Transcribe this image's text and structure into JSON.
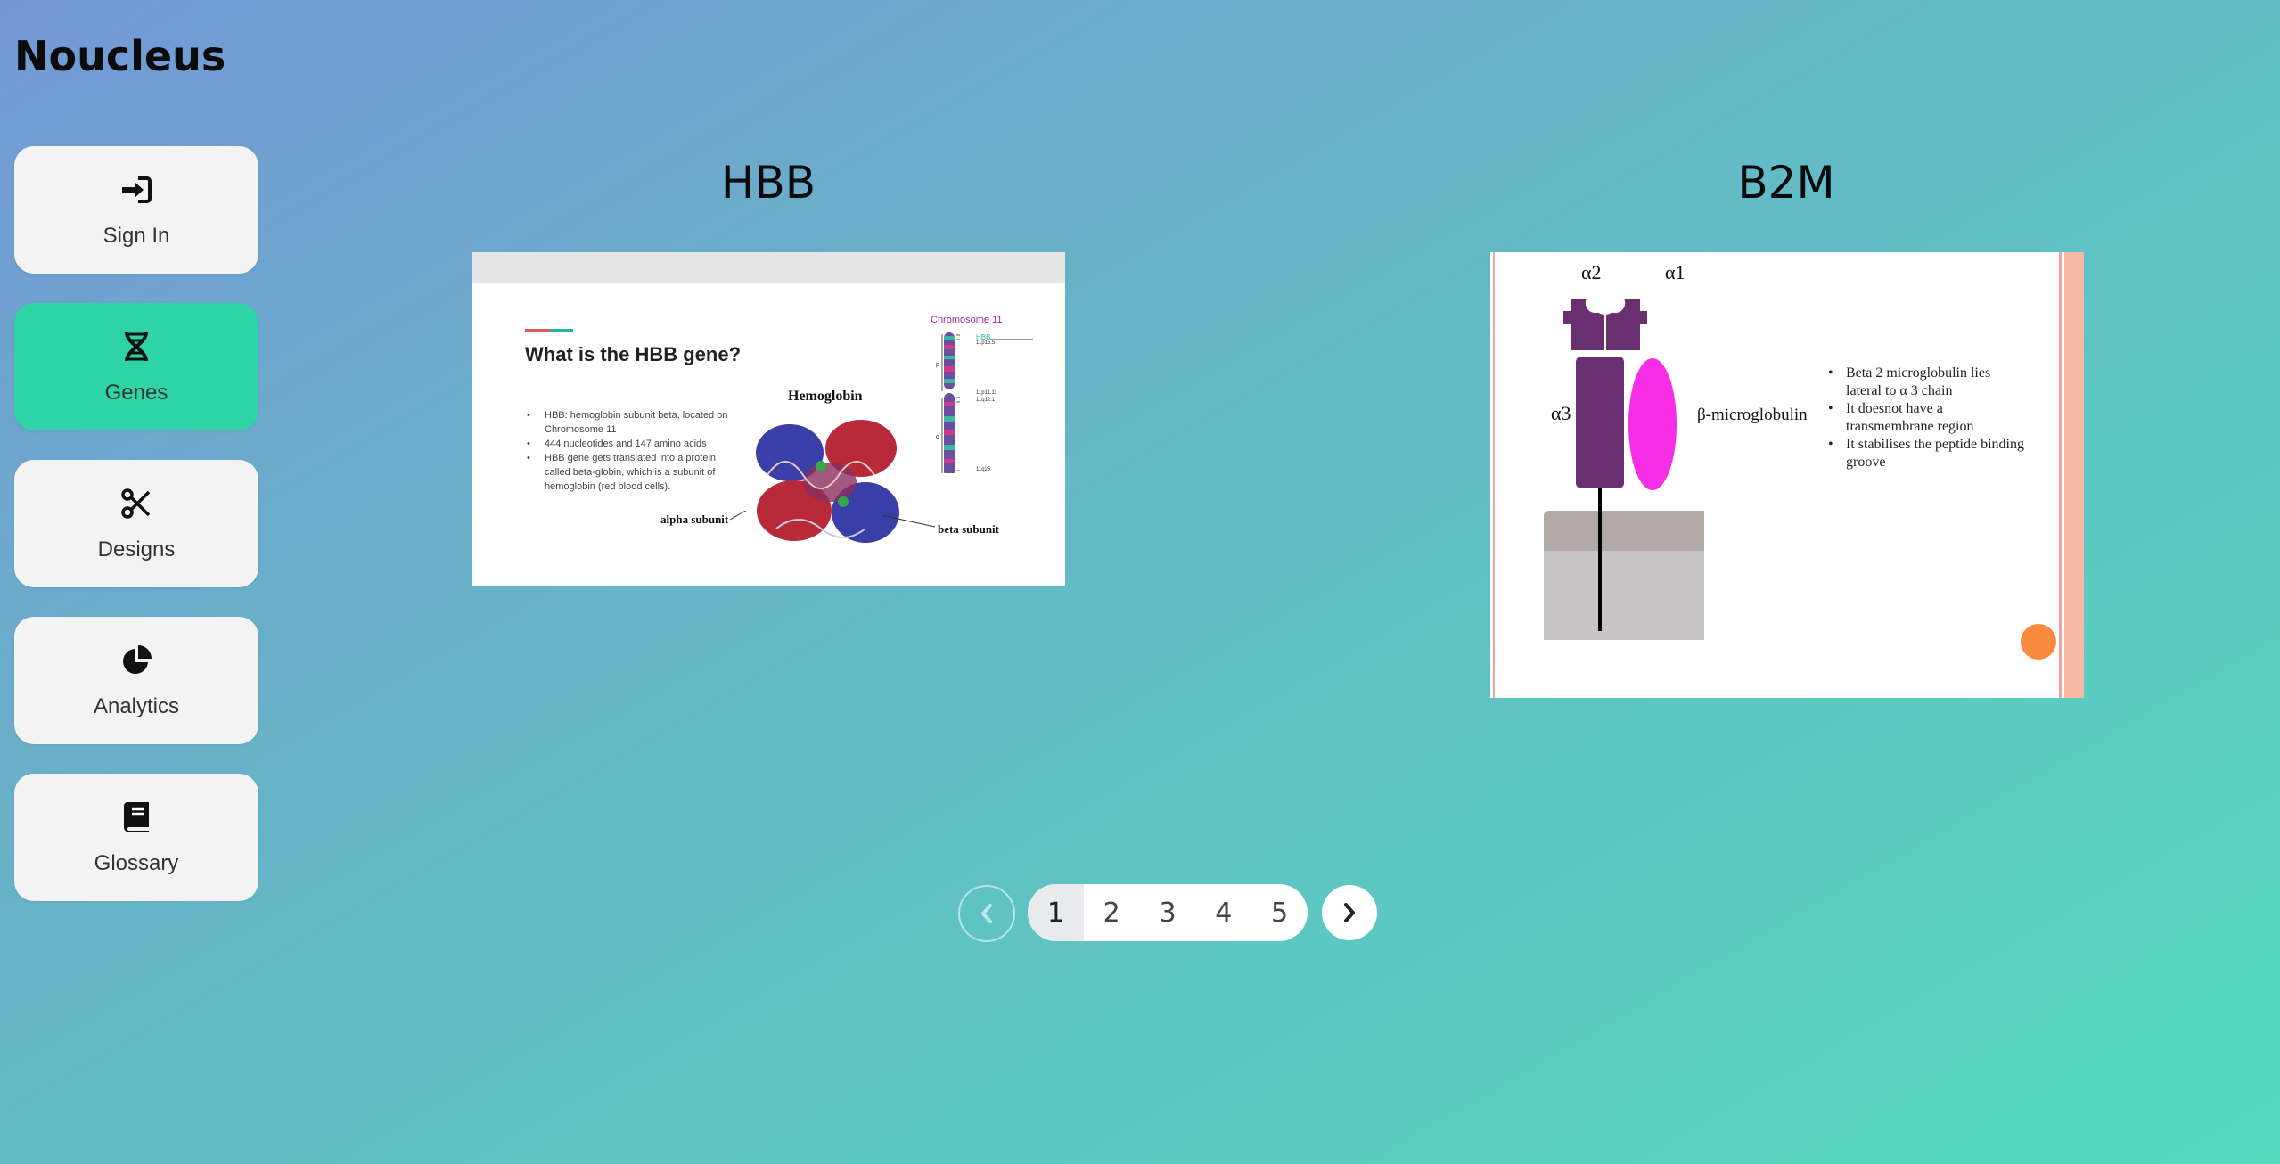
{
  "app": {
    "title": "Noucleus"
  },
  "nav": [
    {
      "label": "Sign In",
      "icon": "sign-in-icon"
    },
    {
      "label": "Genes",
      "icon": "dna-icon",
      "active": true
    },
    {
      "label": "Designs",
      "icon": "scissors-icon"
    },
    {
      "label": "Analytics",
      "icon": "pie-chart-icon"
    },
    {
      "label": "Glossary",
      "icon": "book-icon"
    }
  ],
  "genes": [
    {
      "title": "HBB",
      "slide": {
        "heading": "What is the HBB gene?",
        "bullets": [
          "HBB: hemoglobin subunit beta, located on Chromosome 11",
          "444 nucleotides and 147 amino acids",
          "HBB gene gets translated into a protein called beta-globin, which is a subunit of hemoglobin (red blood cells)."
        ],
        "figure_title": "Hemoglobin",
        "alpha_label": "alpha subunit",
        "beta_label": "beta subunit",
        "chromosome_title": "Chromosome 11",
        "band_labels": [
          "HBB",
          "11p15.5",
          "p",
          "11p11.11",
          "11q12.1",
          "q",
          "11q25"
        ]
      }
    },
    {
      "title": "B2M",
      "slide": {
        "alpha1": "α1",
        "alpha2": "α2",
        "alpha3": "α3",
        "beta_label": "β-microglobulin",
        "bullets": [
          "Beta 2 microglobulin lies lateral to α 3 chain",
          "It doesnot have a transmembrane region",
          "It stabilises the peptide binding groove"
        ]
      }
    }
  ],
  "pagination": {
    "pages": [
      "1",
      "2",
      "3",
      "4",
      "5"
    ],
    "current": "1"
  },
  "colors": {
    "active_nav": "#2fd4a6",
    "nav_bg": "#f3f3f4"
  }
}
